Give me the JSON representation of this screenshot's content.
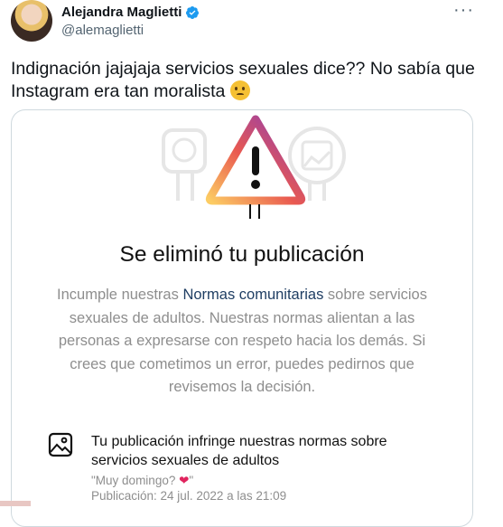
{
  "tweet": {
    "author_name": "Alejandra Maglietti",
    "handle": "@alemaglietti",
    "text": "Indignación jajajaja servicios sexuales dice?? No sabía que Instagram era tan moralista",
    "emoji_icon": "thinking-face-icon",
    "more_icon": "more-horizontal-icon"
  },
  "screenshot": {
    "title": "Se eliminó tu publicación",
    "body_before_link": "Incumple nuestras ",
    "link_text": "Normas comunitarias",
    "body_after_link": " sobre servicios sexuales de adultos. Nuestras normas alientan a las personas a expresarse con respeto hacia los demás. Si crees que cometimos un error, puedes pedirnos que revisemos la decisión.",
    "violation_title": "Tu publicación infringe nuestras normas sobre servicios sexuales de adultos",
    "post_caption": "\"Muy domingo? ",
    "post_caption_end": "\"",
    "post_date": "Publicación: 24 jul. 2022 a las 21:09"
  },
  "colors": {
    "verified": "#1d9bf0",
    "link": "#1f3e63",
    "gradient_start": "#8a3ab9",
    "gradient_mid": "#e95950",
    "gradient_end": "#fccc63"
  }
}
